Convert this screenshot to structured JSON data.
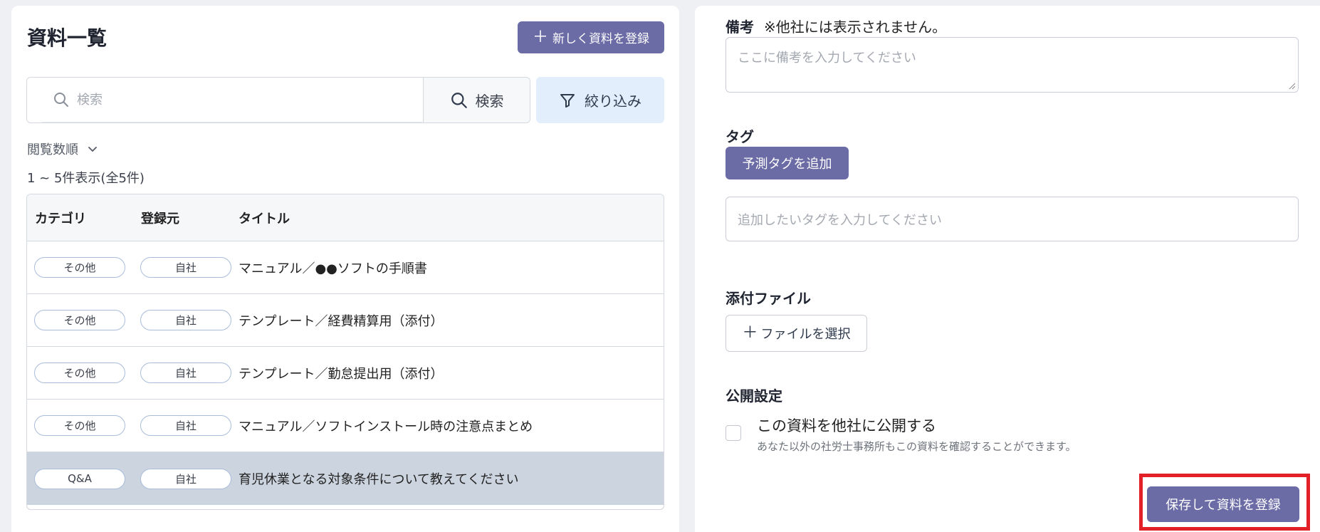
{
  "list": {
    "title": "資料一覧",
    "new_button_label": "新しく資料を登録",
    "search_placeholder": "検索",
    "search_button_label": "検索",
    "filter_button_label": "絞り込み",
    "sort_label": "閲覧数順",
    "result_count": "1 ~ 5件表示(全5件)",
    "columns": [
      "カテゴリ",
      "登録元",
      "タイトル"
    ],
    "rows": [
      {
        "category": "その他",
        "source": "自社",
        "title": "マニュアル／●●ソフトの手順書"
      },
      {
        "category": "その他",
        "source": "自社",
        "title": "テンプレート／経費精算用（添付）"
      },
      {
        "category": "その他",
        "source": "自社",
        "title": "テンプレート／勤怠提出用（添付）"
      },
      {
        "category": "その他",
        "source": "自社",
        "title": "マニュアル／ソフトインストール時の注意点まとめ"
      },
      {
        "category": "Q&A",
        "source": "自社",
        "title": "育児休業となる対象条件について教えてください"
      }
    ]
  },
  "form": {
    "remarks_label": "備考",
    "remarks_note": "※他社には表示されません。",
    "remarks_placeholder": "ここに備考を入力してください",
    "tag_label": "タグ",
    "add_tag_button": "予測タグを追加",
    "tag_placeholder": "追加したいタグを入力してください",
    "attachment_label": "添付ファイル",
    "file_button": "ファイルを選択",
    "visibility_label": "公開設定",
    "public_checkbox_label": "この資料を他社に公開する",
    "public_checkbox_help": "あなた以外の社労士事務所もこの資料を確認することができます。",
    "public_checked": false,
    "save_button": "保存して資料を登録"
  },
  "colors": {
    "primary": "#6b6ba6",
    "filter_bg": "#e3eefc",
    "selected_row": "#ccd4df",
    "highlight": "#e32028",
    "pill_border": "#a9bddb"
  },
  "icons": [
    "plus-icon",
    "search-icon",
    "filter-icon",
    "chevron-down-icon",
    "resize-grip-icon"
  ],
  "state": {
    "selected_row": 4
  }
}
